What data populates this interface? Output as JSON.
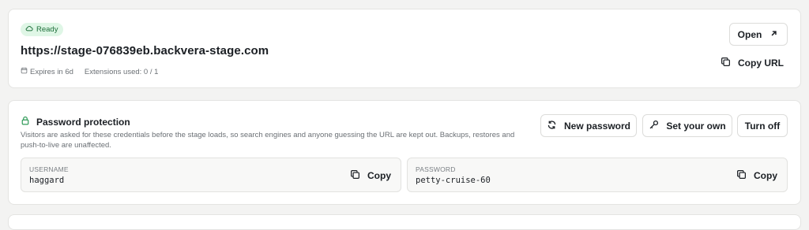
{
  "stage": {
    "status_badge": "Ready",
    "url": "https://stage-076839eb.backvera-stage.com",
    "expires": "Expires in 6d",
    "extensions": "Extensions used: 0 / 1",
    "open_label": "Open",
    "copy_url_label": "Copy URL",
    "icons": [
      "cloud-icon",
      "calendar-icon",
      "external-link-icon",
      "copy-icon"
    ]
  },
  "password": {
    "title": "Password protection",
    "description": "Visitors are asked for these credentials before the stage loads, so search engines and anyone guessing the URL are kept out. Backups, restores and push-to-live are unaffected.",
    "new_password_label": "New password",
    "set_own_label": "Set your own",
    "turn_off_label": "Turn off",
    "username_label": "USERNAME",
    "username_value": "haggard",
    "password_label": "PASSWORD",
    "password_value": "petty-cruise-60",
    "copy_label": "Copy",
    "icons": [
      "lock-icon",
      "refresh-icon",
      "key-icon",
      "copy-icon"
    ]
  },
  "colors": {
    "badge_bg": "#dff6e6",
    "badge_text": "#1d6f3a",
    "page_bg": "#f3f3f2"
  }
}
